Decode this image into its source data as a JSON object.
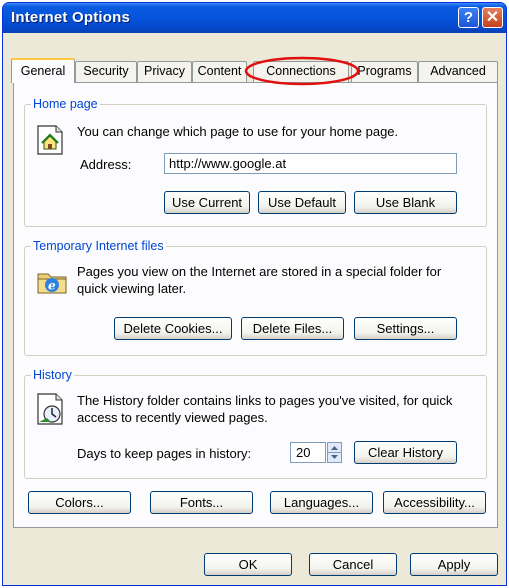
{
  "window": {
    "title": "Internet Options"
  },
  "titlebar": {
    "help_glyph": "?",
    "close_glyph": "✕"
  },
  "tabs": [
    "General",
    "Security",
    "Privacy",
    "Content",
    "Connections",
    "Programs",
    "Advanced"
  ],
  "home_page": {
    "legend": "Home page",
    "description": "You can change which page to use for your home page.",
    "address_label": "Address:",
    "address_value": "http://www.google.at",
    "buttons": {
      "use_current": "Use Current",
      "use_default": "Use Default",
      "use_blank": "Use Blank"
    }
  },
  "temp_files": {
    "legend": "Temporary Internet files",
    "description": "Pages you view on the Internet are stored in a special folder for quick viewing later.",
    "buttons": {
      "delete_cookies": "Delete Cookies...",
      "delete_files": "Delete Files...",
      "settings": "Settings..."
    }
  },
  "history": {
    "legend": "History",
    "description": "The History folder contains links to pages you've visited, for quick access to recently viewed pages.",
    "days_label": "Days to keep pages in history:",
    "days_value": "20",
    "clear_button": "Clear History"
  },
  "bottom_buttons": {
    "colors": "Colors...",
    "fonts": "Fonts...",
    "languages": "Languages...",
    "accessibility": "Accessibility..."
  },
  "dialog_buttons": {
    "ok": "OK",
    "cancel": "Cancel",
    "apply": "Apply"
  },
  "highlight": {
    "tab": "Connections",
    "color": "#e01010"
  }
}
